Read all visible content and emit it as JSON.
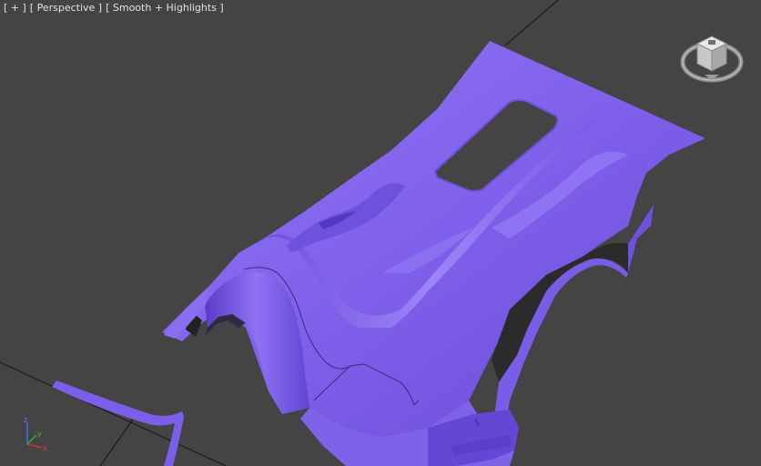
{
  "viewport": {
    "label_plus": "[ + ]",
    "label_view": "[ Perspective ]",
    "label_shading": "[ Smooth + Highlights ]",
    "background_color": "#444444",
    "grid_color": "#1b1b1b",
    "model_color": "#8a6cf0"
  },
  "axis_tripod": {
    "x_label": "x",
    "y_label": "y",
    "z_label": "z"
  },
  "viewcube": {
    "icon": "viewcube-icon"
  }
}
